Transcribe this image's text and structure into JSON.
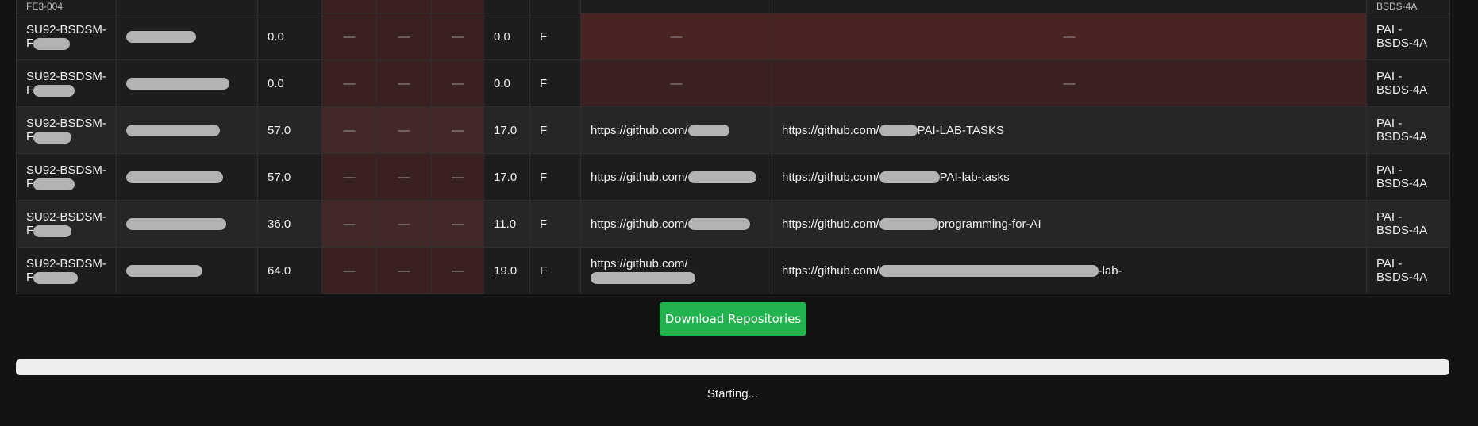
{
  "table": {
    "top_strip": {
      "id_fragment": "FE3-004",
      "group_fragment": "BSDS-4A"
    },
    "dash": "—",
    "rows": [
      {
        "id_prefix": "SU92-BSDSM-",
        "id_suffix": "F",
        "name_visible": "",
        "score": "0.0",
        "total": "0.0",
        "grade": "F",
        "github_profile": "—",
        "github_repo": "—",
        "group_line1": "PAI -",
        "group_line2": "BSDS-4A",
        "highlight": true
      },
      {
        "id_prefix": "SU92-BSDSM-",
        "id_suffix": "F",
        "name_visible": "",
        "score": "0.0",
        "total": "0.0",
        "grade": "F",
        "github_profile": "—",
        "github_repo": "—",
        "group_line1": "PAI -",
        "group_line2": "BSDS-4A",
        "highlight": true
      },
      {
        "id_prefix": "SU92-BSDSM-",
        "id_suffix": "F",
        "name_visible": "",
        "score": "57.0",
        "total": "17.0",
        "grade": "F",
        "github_profile": "https://github.com/",
        "github_repo_prefix": "https://github.com/",
        "github_repo_suffix": "PAI-LAB-TASKS",
        "group_line1": "PAI -",
        "group_line2": "BSDS-4A",
        "highlight": false
      },
      {
        "id_prefix": "SU92-BSDSM-",
        "id_suffix": "F",
        "name_visible": "",
        "score": "57.0",
        "total": "17.0",
        "grade": "F",
        "github_profile": "https://github.com/",
        "github_repo_prefix": "https://github.com/",
        "github_repo_suffix": "PAI-lab-tasks",
        "group_line1": "PAI -",
        "group_line2": "BSDS-4A",
        "highlight": false
      },
      {
        "id_prefix": "SU92-BSDSM-",
        "id_suffix": "F",
        "name_visible": "",
        "score": "36.0",
        "total": "11.0",
        "grade": "F",
        "github_profile": "https://github.com/",
        "github_repo_prefix": "https://github.com/",
        "github_repo_suffix": "programming-for-AI",
        "group_line1": "PAI -",
        "group_line2": "BSDS-4A",
        "highlight": false
      },
      {
        "id_prefix": "SU92-BSDSM-",
        "id_suffix": "F",
        "name_visible": "",
        "score": "64.0",
        "total": "19.0",
        "grade": "F",
        "github_profile": "https://github.com/",
        "github_repo_prefix": "https://github.com/",
        "github_repo_suffix": "-lab-",
        "group_line1": "PAI -",
        "group_line2": "BSDS-4A",
        "highlight": false
      }
    ]
  },
  "download_button": {
    "label": "Download Repositories"
  },
  "progress": {
    "value_percent": 0
  },
  "status": {
    "text": "Starting..."
  },
  "colors": {
    "background": "#131313",
    "accent_green": "#22b34f",
    "highlight_red": "#4a2323",
    "dark_red": "#3a2121"
  }
}
